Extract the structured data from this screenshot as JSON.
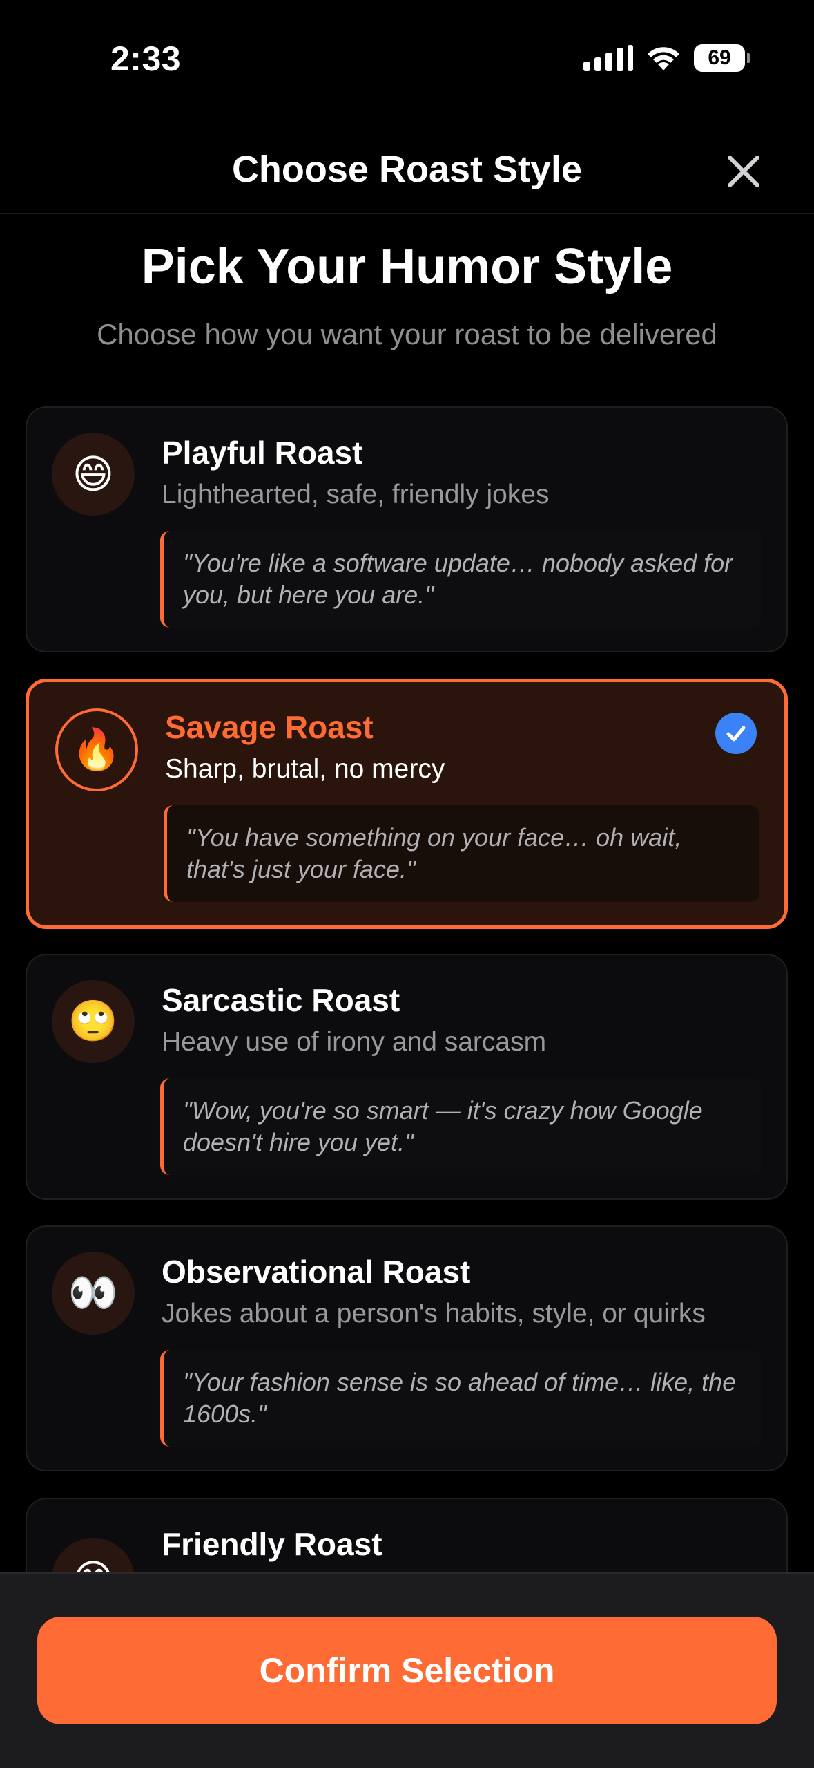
{
  "status_bar": {
    "time": "2:33",
    "battery": "69"
  },
  "header": {
    "title": "Choose Roast Style"
  },
  "intro": {
    "title": "Pick Your Humor Style",
    "subtitle": "Choose how you want your roast to be delivered"
  },
  "styles": [
    {
      "emoji": "😄",
      "title": "Playful Roast",
      "description": "Lighthearted, safe, friendly jokes",
      "example": "\"You're like a software update… nobody asked for you, but here you are.\"",
      "selected": false
    },
    {
      "emoji": "🔥",
      "title": "Savage Roast",
      "description": "Sharp, brutal, no mercy",
      "example": "\"You have something on your face… oh wait, that's just your face.\"",
      "selected": true
    },
    {
      "emoji": "🙄",
      "title": "Sarcastic Roast",
      "description": "Heavy use of irony and sarcasm",
      "example": "\"Wow, you're so smart — it's crazy how Google doesn't hire you yet.\"",
      "selected": false
    },
    {
      "emoji": "👀",
      "title": "Observational Roast",
      "description": "Jokes about a person's habits, style, or quirks",
      "example": "\"Your fashion sense is so ahead of time… like, the 1600s.\"",
      "selected": false
    },
    {
      "emoji": "😊",
      "title": "Friendly Roast",
      "selected": false
    }
  ],
  "footer": {
    "confirm_label": "Confirm Selection"
  },
  "colors": {
    "accent": "#ff6b35",
    "check": "#3b82f6",
    "background": "#000000"
  },
  "icons": {
    "close": "close-icon",
    "check": "checkmark-icon",
    "signal": "cellular-signal-icon",
    "wifi": "wifi-icon",
    "battery": "battery-icon"
  }
}
